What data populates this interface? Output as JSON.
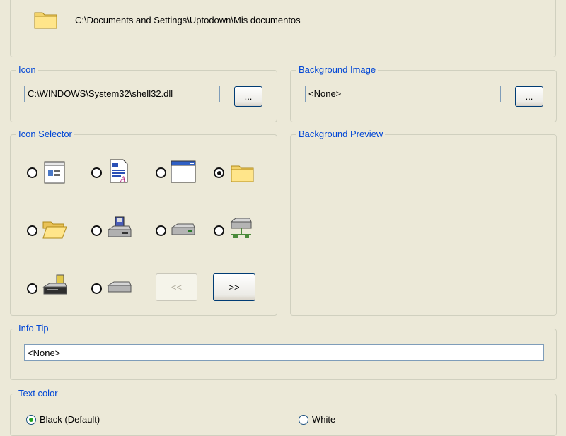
{
  "preview": {
    "path": "C:\\Documents and Settings\\Uptodown\\Mis documentos",
    "icon": "folder-icon"
  },
  "icon_group": {
    "legend": "Icon",
    "file": "C:\\WINDOWS\\System32\\shell32.dll",
    "browse_label": "..."
  },
  "background_group": {
    "legend": "Background Image",
    "file": "<None>",
    "browse_label": "..."
  },
  "icon_selector": {
    "legend": "Icon Selector",
    "icons": [
      {
        "name": "window-properties-icon",
        "selected": false
      },
      {
        "name": "document-text-icon",
        "selected": false
      },
      {
        "name": "application-window-icon",
        "selected": false
      },
      {
        "name": "folder-icon",
        "selected": true
      },
      {
        "name": "open-folder-icon",
        "selected": false
      },
      {
        "name": "floppy-drive-icon",
        "selected": false
      },
      {
        "name": "hard-drive-icon",
        "selected": false
      },
      {
        "name": "network-drive-icon",
        "selected": false
      },
      {
        "name": "cd-drive-icon",
        "selected": false
      },
      {
        "name": "removable-drive-icon",
        "selected": false
      }
    ],
    "prev_label": "<<",
    "next_label": ">>"
  },
  "background_preview": {
    "legend": "Background Preview"
  },
  "info_tip": {
    "legend": "Info Tip",
    "value": "<None>"
  },
  "text_color": {
    "legend": "Text color",
    "options": [
      {
        "label": "Black (Default)",
        "selected": true
      },
      {
        "label": "White",
        "selected": false
      }
    ]
  }
}
